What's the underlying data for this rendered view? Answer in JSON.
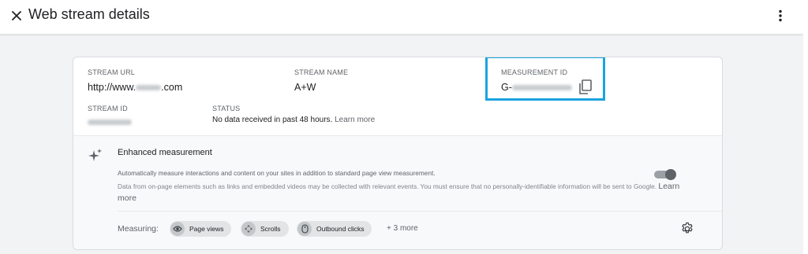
{
  "header": {
    "title": "Web stream details",
    "close_icon": "close-icon",
    "more_icon": "more-vert-icon"
  },
  "stream": {
    "url_label": "STREAM URL",
    "url_prefix": "http://www.",
    "url_suffix": ".com",
    "name_label": "STREAM NAME",
    "name_value": "A+W",
    "measurement_label": "MEASUREMENT ID",
    "measurement_prefix": "G-",
    "id_label": "STREAM ID",
    "status_label": "STATUS",
    "status_text": "No data received in past 48 hours.",
    "status_link": "Learn more"
  },
  "enhanced": {
    "title": "Enhanced measurement",
    "desc1": "Automatically measure interactions and content on your sites in addition to standard page view measurement.",
    "desc2": "Data from on-page elements such as links and embedded videos may be collected with relevant events. You must ensure that no personally-identifiable information will be sent to Google.",
    "desc_link": "Learn more",
    "toggle_on": true,
    "measuring_label": "Measuring:",
    "chips": [
      {
        "label": "Page views",
        "icon": "eye-icon"
      },
      {
        "label": "Scrolls",
        "icon": "scroll-icon"
      },
      {
        "label": "Outbound clicks",
        "icon": "mouse-icon"
      }
    ],
    "more": "+ 3 more"
  },
  "colors": {
    "highlight": "#1aa3e0",
    "background": "#f1f3f4"
  }
}
